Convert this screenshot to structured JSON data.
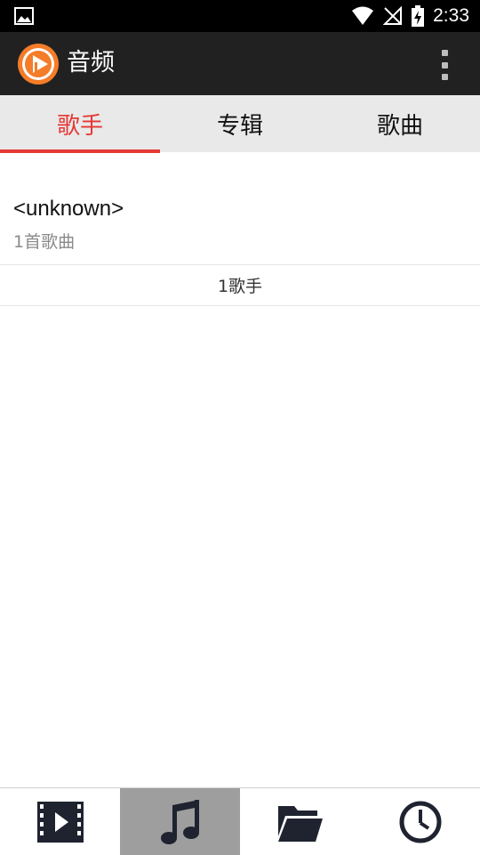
{
  "status_bar": {
    "time": "2:33",
    "icons": [
      "image-notification-icon",
      "wifi-icon",
      "no-signal-icon",
      "battery-charging-icon"
    ]
  },
  "app_bar": {
    "title": "音频",
    "menu_icon": "more-vert-icon",
    "logo_icon": "play-logo-icon"
  },
  "tabs": [
    {
      "label": "歌手",
      "active": true
    },
    {
      "label": "专辑",
      "active": false
    },
    {
      "label": "歌曲",
      "active": false
    }
  ],
  "artists": [
    {
      "name": "<unknown>",
      "song_count": "1首歌曲"
    }
  ],
  "summary": "1歌手",
  "bottom_nav": [
    {
      "icon": "video-icon",
      "active": false
    },
    {
      "icon": "music-note-icon",
      "active": true
    },
    {
      "icon": "folder-icon",
      "active": false
    },
    {
      "icon": "clock-icon",
      "active": false
    }
  ],
  "colors": {
    "accent": "#e53935",
    "app_bar": "#212121",
    "status_bar": "#000000",
    "tab_bar": "#e9e9e9",
    "logo": "#f57c28",
    "nav_active": "#9e9e9e",
    "nav_icon": "#1f2330"
  }
}
